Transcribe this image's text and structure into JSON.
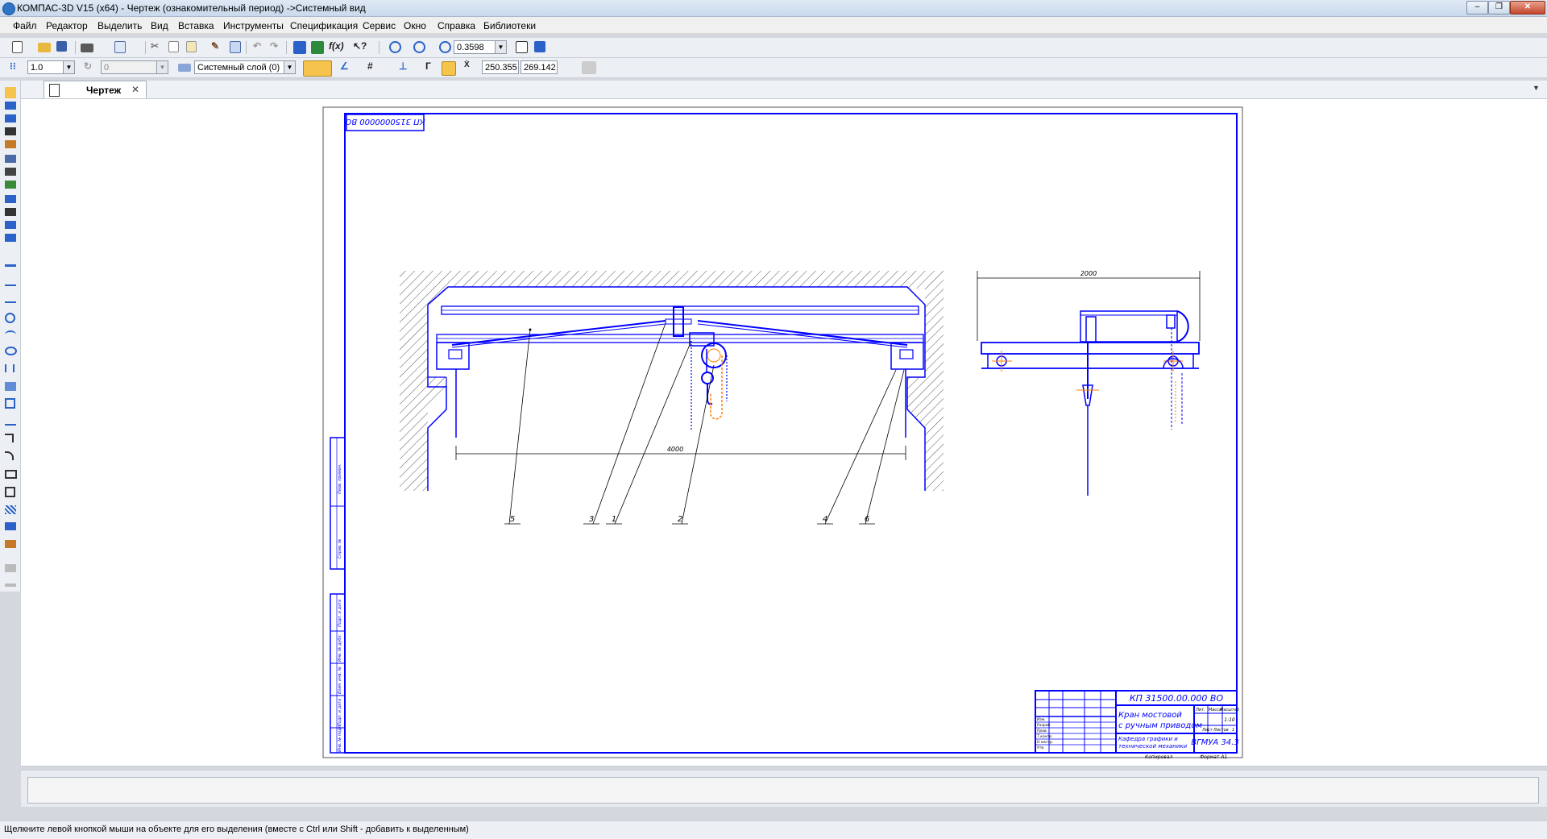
{
  "window": {
    "title": "КОМПАС-3D V15 (x64) - Чертеж (ознакомительный период) ->Системный вид",
    "minimize": "–",
    "restore": "❐",
    "close": "✕"
  },
  "menu": [
    "Файл",
    "Редактор",
    "Выделить",
    "Вид",
    "Вставка",
    "Инструменты",
    "Спецификация",
    "Сервис",
    "Окно",
    "Справка",
    "Библиотеки"
  ],
  "toolbar": {
    "zoom_value": "0.3598",
    "line_scale": "1.0",
    "step_angle": "0",
    "layer": "Системный слой (0)",
    "coord_x": "250.355",
    "coord_y": "269.142",
    "fx_label": "f(x)"
  },
  "tab": {
    "label": "Чертеж",
    "close": "✕"
  },
  "drawing": {
    "doc_code_rotated": "КП 3150000000 ВО",
    "doc_code": "КП 31500.00.000 ВО",
    "name_line1": "Кран мостовой",
    "name_line2": "с ручным приводом",
    "org": "ВГМУА 34.3",
    "scale": "1:10",
    "sheet_label": "Лист",
    "sheets_label": "Листов",
    "sheets_count": "1",
    "lit_label": "Лит.",
    "mass_label": "Масса",
    "scale_label": "Масштаб",
    "dept_line1": "Кафедра графики и",
    "dept_line2": "технической механики",
    "copied": "Копировал",
    "format": "Формат А1",
    "dim_span": "4000",
    "dim_side": "2000",
    "callouts": [
      "5",
      "3",
      "1",
      "2",
      "4",
      "6"
    ],
    "title_rows": [
      "Изм.",
      "Разраб.",
      "Пров.",
      "Т.контр.",
      "Н.контр.",
      "Утв."
    ],
    "side_labels": [
      "Перв. примен.",
      "Справ. №",
      "Подп. и дата",
      "Инв. № дубл.",
      "Взам. инв. №",
      "Подп. и дата",
      "Инв. № подл."
    ]
  },
  "status": "Щелкните левой кнопкой мыши на объекте для его выделения (вместе с Ctrl или Shift - добавить к выделенным)",
  "colors": {
    "drawing_blue": "#0000ff",
    "axis_orange": "#ff7f00",
    "hatch": "#555555"
  }
}
